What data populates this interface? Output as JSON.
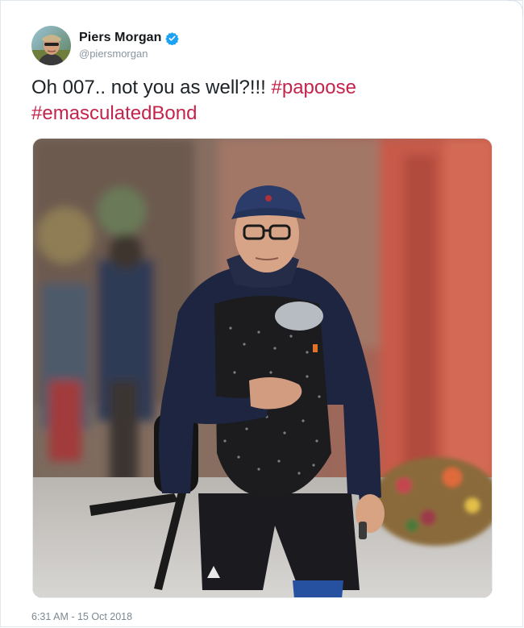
{
  "tweet": {
    "author": {
      "display_name": "Piers Morgan",
      "handle": "@piersmorgan",
      "verified": true,
      "avatar_icon": "profile-avatar"
    },
    "text_plain": "Oh 007.. not you as well?!!! ",
    "hashtags": [
      "#papoose",
      "#emasculatedBond"
    ],
    "media": {
      "type": "photo",
      "icon": "photo-of-man-with-baby-carrier"
    },
    "timestamp": "6:31 AM - 15 Oct 2018"
  },
  "colors": {
    "hashtag": "#c4244b",
    "verified_badge": "#1da1f2",
    "text": "#1c2226",
    "secondary_text": "#8a959e"
  }
}
